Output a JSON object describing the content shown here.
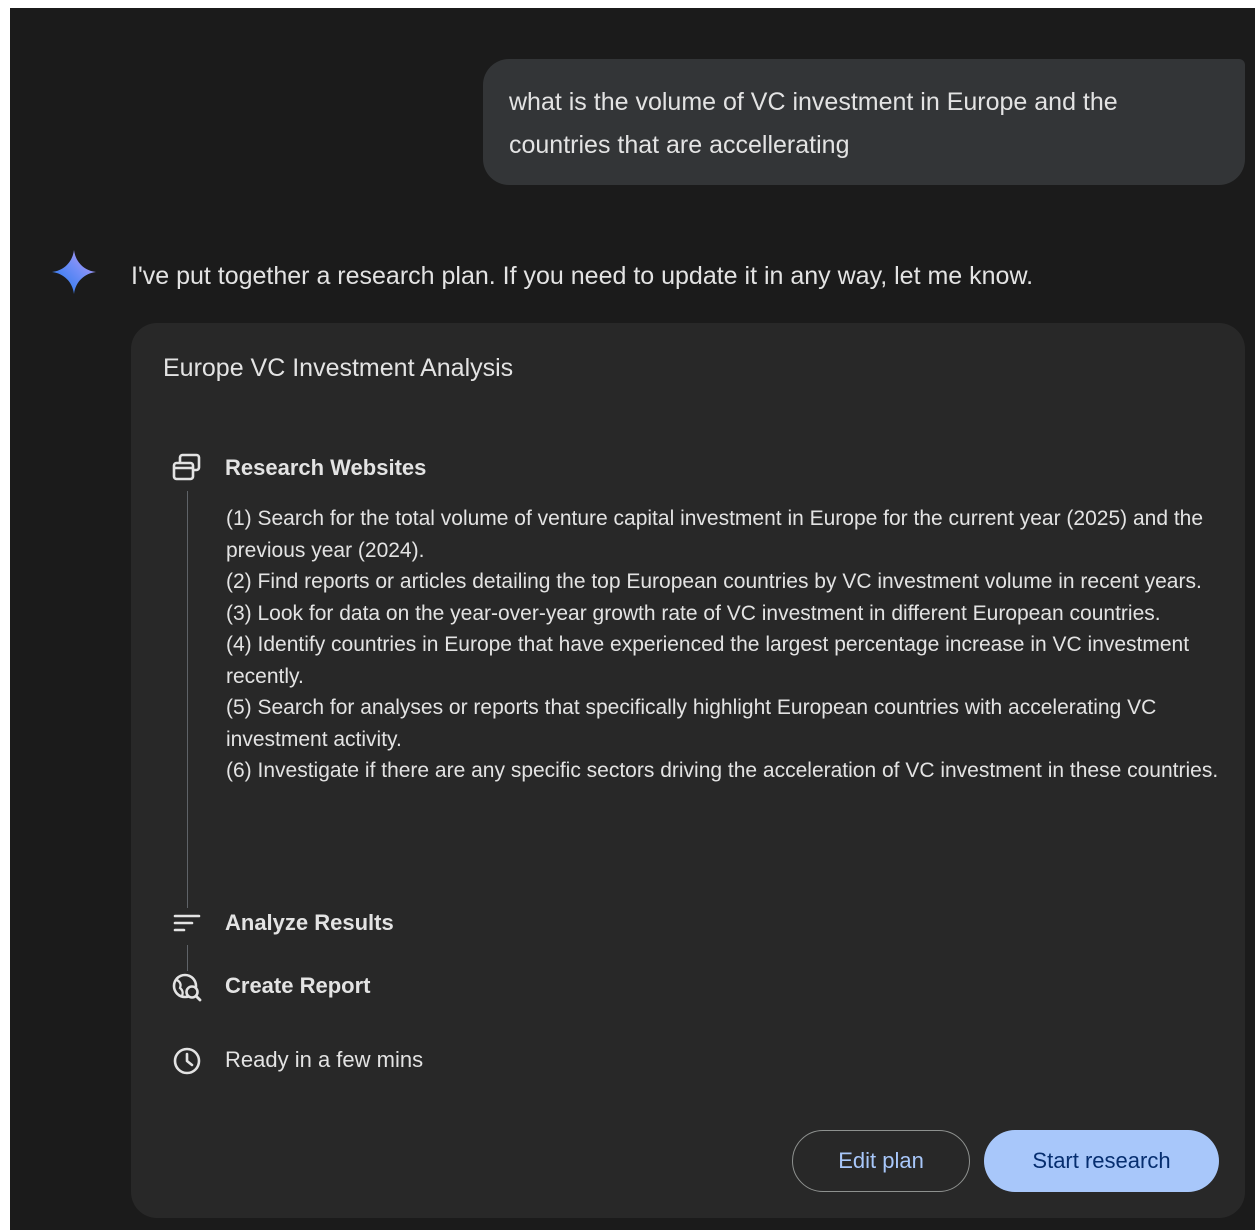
{
  "conversation": {
    "user_message": "what is the volume of VC investment in Europe and the countries that are accellerating",
    "assistant_intro": "I've put together a research plan. If you need to update it in any way, let me know."
  },
  "plan": {
    "title": "Europe VC Investment Analysis",
    "stages": [
      {
        "label": "Research Websites",
        "icon": "browser-windows-icon"
      },
      {
        "label": "Analyze Results",
        "icon": "sort-lines-icon"
      },
      {
        "label": "Create Report",
        "icon": "globe-search-icon"
      }
    ],
    "steps": [
      "(1) Search for the total volume of venture capital investment in Europe for the current year (2025) and the previous year (2024).",
      "(2) Find reports or articles detailing the top European countries by VC investment volume in recent years.",
      "(3) Look for data on the year-over-year growth rate of VC investment in different European countries.",
      "(4) Identify countries in Europe that have experienced the largest percentage increase in VC investment recently.",
      "(5) Search for analyses or reports that specifically highlight European countries with accelerating VC investment activity.",
      "(6) Investigate if there are any specific sectors driving the acceleration of VC investment in these countries."
    ],
    "eta": {
      "label": "Ready in a few mins",
      "icon": "clock-icon"
    }
  },
  "actions": {
    "edit_label": "Edit plan",
    "start_label": "Start research"
  },
  "colors": {
    "background": "#1b1b1b",
    "card": "#282828",
    "user_bubble": "#333537",
    "text": "#e3e3e3",
    "accent": "#a8c7fa",
    "accent_text": "#062e6f"
  }
}
